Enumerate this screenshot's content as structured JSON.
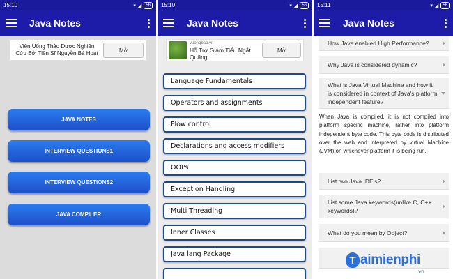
{
  "app_title": "Java Notes",
  "screen1": {
    "status_time": "15:10",
    "battery": "56",
    "ad": {
      "text": "Viên Uống Thảo Dược Nghiên Cứu Bởi Tiến Sĩ Nguyễn Bá Hoạt",
      "button": "Mở"
    },
    "buttons": [
      "JAVA NOTES",
      "INTERVIEW QUESTIONS1",
      "INTERVIEW QUESTIONS2",
      "JAVA COMPILER"
    ]
  },
  "screen2": {
    "status_time": "15:10",
    "battery": "56",
    "ad": {
      "domain": "vuongbao.vn",
      "title": "Hỗ Trợ Giảm Tiểu Ngắt Quãng",
      "button": "Mở"
    },
    "topics": [
      "Language Fundamentals",
      "Operators and assignments",
      "Flow control",
      "Declarations and access modifiers",
      "OOPs",
      "Exception Handling",
      "Multi Threading",
      "Inner Classes",
      "Java lang Package"
    ]
  },
  "screen3": {
    "status_time": "15:11",
    "battery": "56",
    "questions": [
      "How Java enabled High Performance?",
      "Why Java is considered dynamic?",
      "What is Java Virtual Machine and how it is considered in context of Java's platform independent feature?",
      "List two Java IDE's?",
      "List some Java keywords(unlike C, C++ keywords)?",
      "What do you mean by Object?"
    ],
    "answer": "When Java is compiled, it is not compiled into platform specific machine, rather into platform independent byte code. This byte code is distributed over the web and interpreted by virtual Machine (JVM) on whichever platform it is being run."
  },
  "watermark": {
    "brand": "aimienphi",
    "badge": "T",
    "suffix": ".vn"
  },
  "colors": {
    "appbar": "#1c1ca8",
    "button": "#2b7cf0",
    "topic_border": "#1e4a8a"
  }
}
